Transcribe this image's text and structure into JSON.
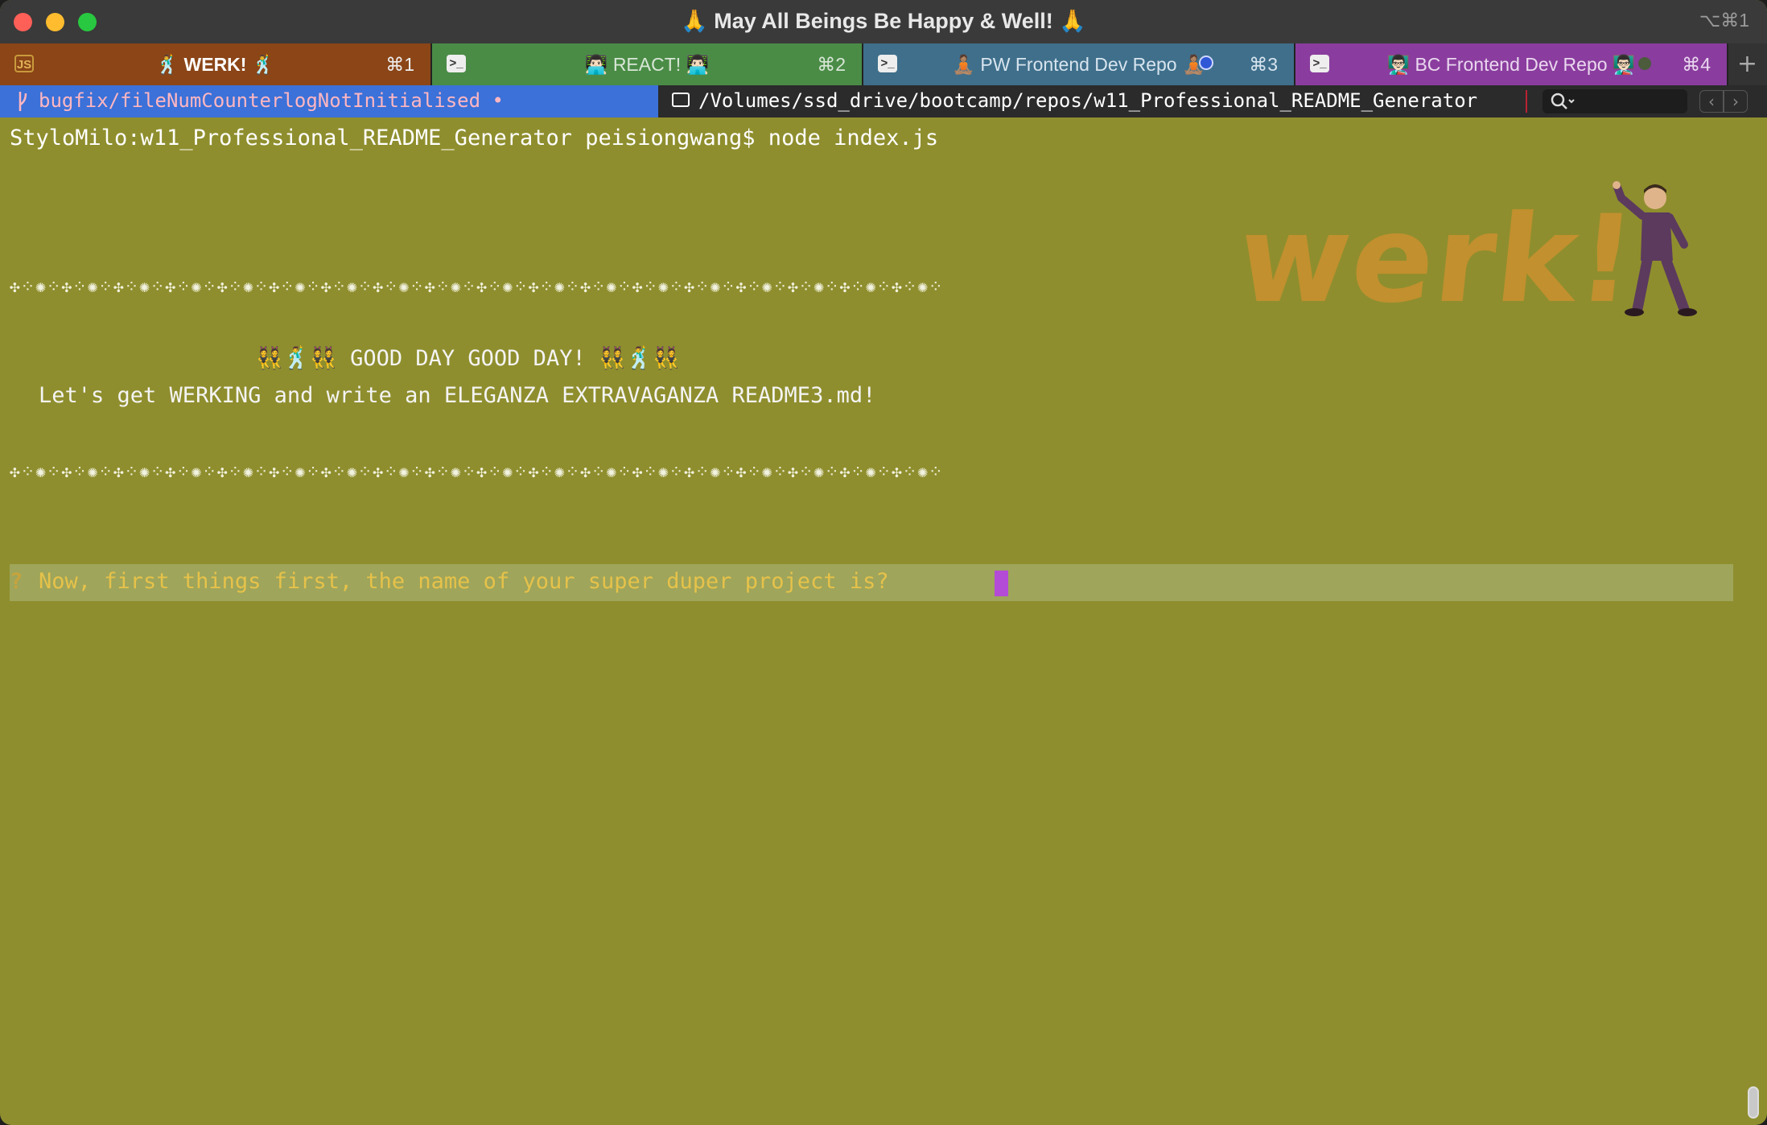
{
  "window": {
    "title": "🙏 May All Beings Be Happy & Well! 🙏",
    "shortcut": "⌥⌘1"
  },
  "tabs": [
    {
      "icon": "JS",
      "label": "🕺 WERK! 🕺",
      "shortcut": "⌘1",
      "color": "#8b4517"
    },
    {
      "icon": ">_",
      "label": "👨🏻‍💻 REACT! 👨🏻‍💻",
      "shortcut": "⌘2",
      "color": "#4a8c46"
    },
    {
      "icon": ">_",
      "label": "🧘🏽 PW Frontend Dev Repo 🧘🏽",
      "shortcut": "⌘3",
      "color": "#3f6f8b"
    },
    {
      "icon": ">_",
      "label": "👨🏻‍🏫 BC Frontend Dev Repo 👨🏻‍🏫",
      "shortcut": "⌘4",
      "color": "#8a3d9e"
    }
  ],
  "tab_add": "+",
  "status": {
    "branch": "bugfix/fileNumCounterlogNotInitialised •",
    "path": "/Volumes/ssd_drive/bootcamp/repos/w11_Professional_README_Generator",
    "search_placeholder": "",
    "nav_prev": "‹",
    "nav_next": "›"
  },
  "terminal": {
    "command_line": "StyloMilo:w11_Professional_README_Generator peisiongwang$ node index.js",
    "decoration": "✣⁘✺⁘✣⁘✺⁘✣⁘✺⁘✣⁘✺⁘✣⁘✺⁘✣⁘✺⁘✣⁘✺⁘✣⁘✺⁘✣⁘✺⁘✣⁘✺⁘✣⁘✺⁘✣⁘✺⁘✣⁘✺⁘✣⁘✺⁘✣⁘✺⁘✣⁘✺⁘✣⁘✺⁘✣⁘✺⁘",
    "greeting": "👯🕺👯 GOOD DAY GOOD DAY! 👯🕺👯",
    "subtitle": "Let's get WERKING and write an ELEGANZA EXTRAVAGANZA README3.md!",
    "prompt_mark": "?",
    "prompt": "Now, first things first, the name of your super duper project is?",
    "logo": "werk!"
  },
  "colors": {
    "terminal_bg": "#8f8e2e",
    "prompt_bar": "#9fa55a",
    "prompt_text": "#e6c24a",
    "cursor": "#b44bd6",
    "branch_bg": "#3b71d8"
  }
}
